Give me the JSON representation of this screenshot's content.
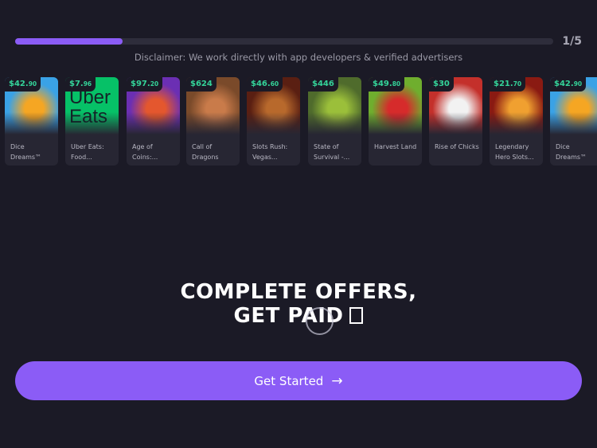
{
  "progress": {
    "step_label": "1/5",
    "fraction": 0.2
  },
  "disclaimer": "Disclaimer: We work directly with app developers & verified advertisers",
  "offers": [
    {
      "price_main": "$42.",
      "price_cents": "90",
      "title": "Dice Dreams™",
      "icon": "dice-dreams-art",
      "colors": [
        "#3aa2e6",
        "#f5a623"
      ]
    },
    {
      "price_main": "$7.",
      "price_cents": "96",
      "title": "Uber Eats: Food...",
      "icon": "uber-eats-logo",
      "colors": [
        "#06c167",
        "#142328"
      ],
      "logo_line1": "Uber",
      "logo_line2": "Eats"
    },
    {
      "price_main": "$97.",
      "price_cents": "20",
      "title": "Age of Coins:...",
      "icon": "age-of-coins-art",
      "colors": [
        "#6b2fb3",
        "#e4572e"
      ]
    },
    {
      "price_main": "$624",
      "price_cents": "",
      "title": "Call of Dragons",
      "icon": "call-of-dragons-art",
      "colors": [
        "#7a4a2a",
        "#c97b4a"
      ]
    },
    {
      "price_main": "$46.",
      "price_cents": "60",
      "title": "Slots Rush: Vegas...",
      "icon": "slots-rush-art",
      "colors": [
        "#5a1f12",
        "#b8692c"
      ]
    },
    {
      "price_main": "$446",
      "price_cents": "",
      "title": "State of Survival -...",
      "icon": "state-of-survival-art",
      "colors": [
        "#4f6b2c",
        "#9bbf3a"
      ]
    },
    {
      "price_main": "$49.",
      "price_cents": "80",
      "title": "Harvest Land",
      "icon": "harvest-land-art",
      "colors": [
        "#6fae2e",
        "#d62b2b"
      ]
    },
    {
      "price_main": "$30",
      "price_cents": "",
      "title": "Rise of Chicks",
      "icon": "rise-of-chicks-art",
      "colors": [
        "#c4302b",
        "#f2f2f2"
      ]
    },
    {
      "price_main": "$21.",
      "price_cents": "70",
      "title": "Legendary Hero Slots...",
      "icon": "legendary-hero-slots-art",
      "colors": [
        "#8a1a12",
        "#f0a030"
      ]
    },
    {
      "price_main": "$42.",
      "price_cents": "90",
      "title": "Dice Dreams™",
      "icon": "dice-dreams-art",
      "colors": [
        "#3aa2e6",
        "#f5a623"
      ]
    }
  ],
  "headline": {
    "line1": "COMPLETE OFFERS,",
    "line2": "GET PAID"
  },
  "cta": {
    "label": "Get Started",
    "arrow": "→"
  },
  "theme": {
    "background": "#1b1a26",
    "accent": "#8b5cf6",
    "price_green": "#34d399"
  }
}
